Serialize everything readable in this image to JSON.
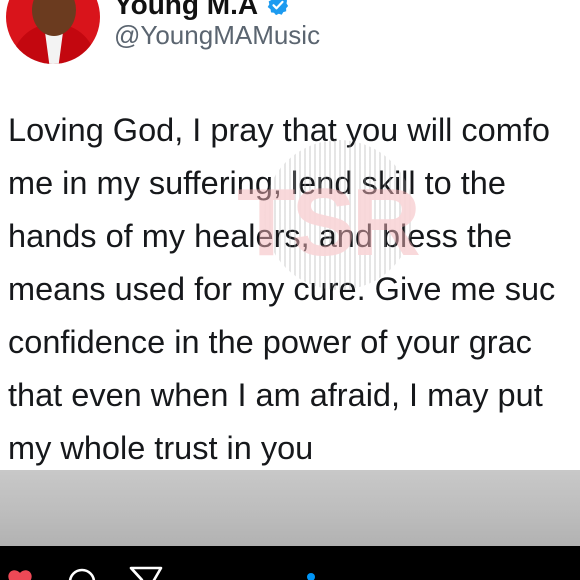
{
  "tweet": {
    "display_name": "Young M.A",
    "handle": "@YoungMAMusic",
    "verified": true,
    "text": "Loving God, I pray that you will comfo\nme in my suffering, lend skill to the\nhands of my healers, and bless the\nmeans used for my cure. Give me suc\nconfidence in the power of your grac\nthat even when I am afraid, I may put\nmy whole trust in you"
  },
  "watermark": {
    "label": "TSR"
  },
  "colors": {
    "verified_badge": "#1d9bf0",
    "heart": "#ed4956",
    "bottom_bar": "#000000",
    "carousel_dot": "#0095f6"
  },
  "icons": {
    "like": "heart-icon",
    "comment": "comment-icon",
    "share": "send-icon",
    "carousel": "carousel-dot-icon"
  }
}
